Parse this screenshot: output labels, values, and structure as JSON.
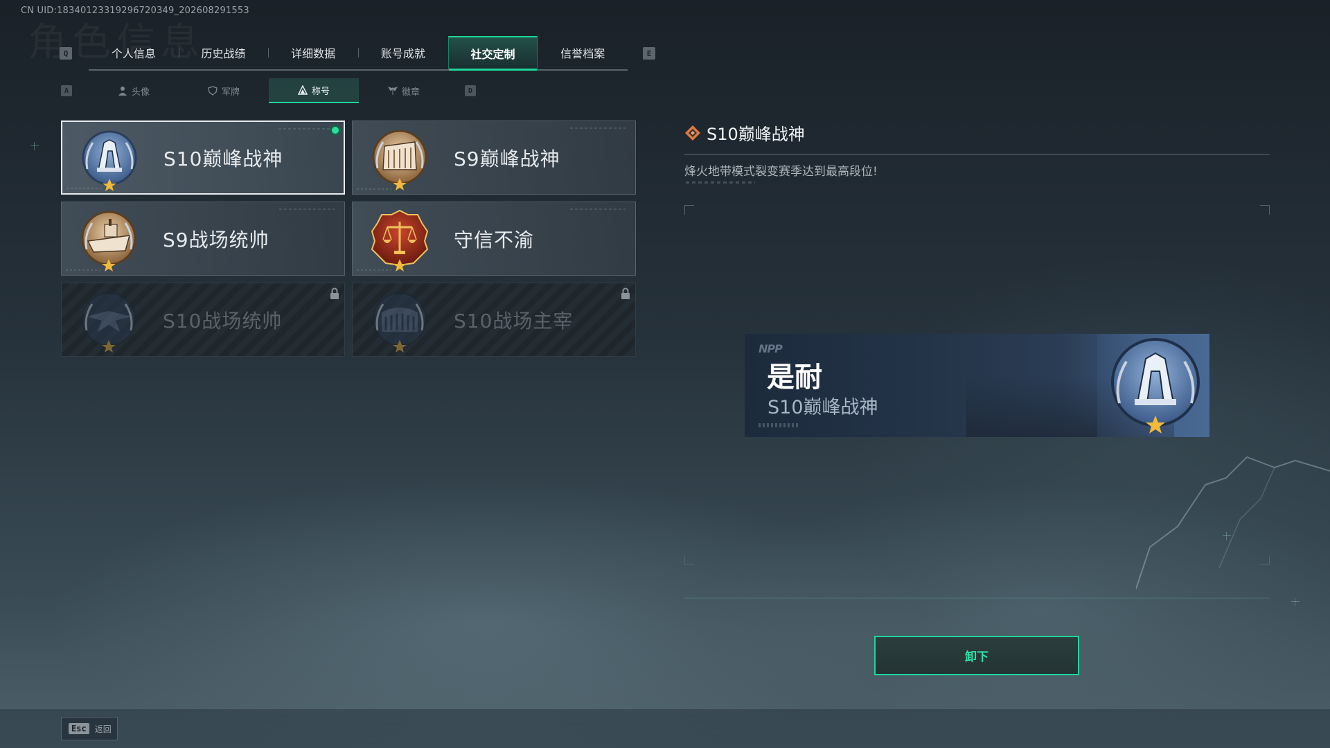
{
  "uid_text": "CN UID:18340123319296720349_202608291553",
  "watermark": "角色信息",
  "keys": {
    "prev_main": "Q",
    "next_main": "E",
    "prev_sub": "A",
    "next_sub": "D"
  },
  "main_tabs": [
    {
      "label": "个人信息",
      "active": false
    },
    {
      "label": "历史战绩",
      "active": false
    },
    {
      "label": "详细数据",
      "active": false
    },
    {
      "label": "账号成就",
      "active": false
    },
    {
      "label": "社交定制",
      "active": true
    },
    {
      "label": "信誉档案",
      "active": false
    }
  ],
  "sub_tabs": [
    {
      "label": "头像",
      "icon": "person-icon",
      "active": false
    },
    {
      "label": "军牌",
      "icon": "shield-icon",
      "active": false
    },
    {
      "label": "称号",
      "icon": "triangle-icon",
      "active": true
    },
    {
      "label": "徽章",
      "icon": "wings-icon",
      "active": false
    }
  ],
  "titles": [
    {
      "label": "S10巅峰战神",
      "emblem": "blue-tower-emblem",
      "selected": true,
      "equipped": true,
      "locked": false
    },
    {
      "label": "S9巅峰战神",
      "emblem": "bronze-building-emblem",
      "selected": false,
      "equipped": false,
      "locked": false
    },
    {
      "label": "S9战场统帅",
      "emblem": "bronze-ship-emblem",
      "selected": false,
      "equipped": false,
      "locked": false
    },
    {
      "label": "守信不渝",
      "emblem": "red-scales-emblem",
      "selected": false,
      "equipped": false,
      "locked": false
    },
    {
      "label": "S10战场统帅",
      "emblem": "blue-jet-emblem",
      "selected": false,
      "equipped": false,
      "locked": true
    },
    {
      "label": "S10战场主宰",
      "emblem": "blue-colosseum-emblem",
      "selected": false,
      "equipped": false,
      "locked": true
    }
  ],
  "detail": {
    "title": "S10巅峰战神",
    "description": "烽火地带模式裂变赛季达到最高段位!",
    "icon": "diamond-icon"
  },
  "nameplate": {
    "logo": "NPP",
    "player_name": "是耐",
    "title": "S10巅峰战神",
    "emblem": "blue-tower-emblem"
  },
  "actions": {
    "unequip_label": "卸下"
  },
  "footer": {
    "esc_key": "Esc",
    "back_label": "返回"
  },
  "colors": {
    "accent": "#1fd69a",
    "bronze": "#b58a5a",
    "steel_blue": "#5a7fae",
    "crimson": "#9a2c1c"
  }
}
